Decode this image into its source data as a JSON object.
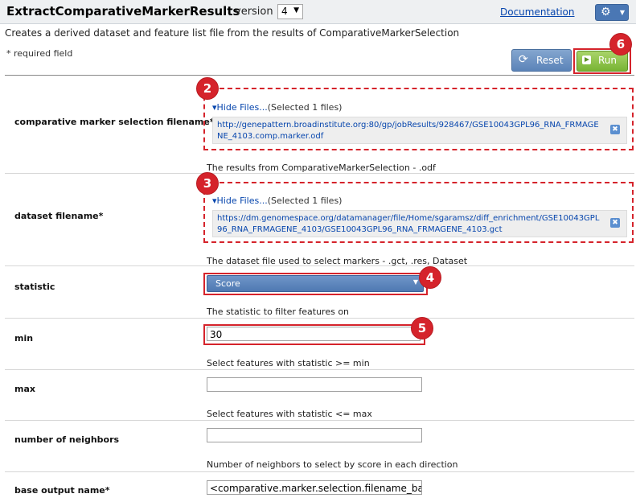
{
  "header": {
    "title": "ExtractComparativeMarkerResults",
    "version_label": "version",
    "version_value": "4",
    "documentation_link": "Documentation",
    "gear_icon": "gear-icon"
  },
  "subtitle": "Creates a derived dataset and feature list file from the results of ComparativeMarkerSelection",
  "required_note": "* required field",
  "actions": {
    "reset_label": "Reset",
    "run_label": "Run"
  },
  "params": {
    "cms_filename": {
      "label": "comparative marker selection filename*",
      "toggle": "▾Hide Files...",
      "selected": "(Selected 1 files)",
      "file": "http://genepattern.broadinstitute.org:80/gp/jobResults/928467/GSE10043GPL96_RNA_FRMAGENE_4103.comp.marker.odf",
      "description": "The results from ComparativeMarkerSelection - .odf"
    },
    "dataset_filename": {
      "label": "dataset filename*",
      "toggle": "▾Hide Files...",
      "selected": "(Selected 1 files)",
      "file": "https://dm.genomespace.org/datamanager/file/Home/sgaramsz/diff_enrichment/GSE10043GPL96_RNA_FRMAGENE_4103/GSE10043GPL96_RNA_FRMAGENE_4103.gct",
      "description": "The dataset file used to select markers - .gct, .res, Dataset"
    },
    "statistic": {
      "label": "statistic",
      "value": "Score",
      "description": "The statistic to filter features on"
    },
    "min": {
      "label": "min",
      "value": "30",
      "description": "Select features with statistic >= min"
    },
    "max": {
      "label": "max",
      "value": "",
      "description": "Select features with statistic <= max"
    },
    "neighbors": {
      "label": "number of neighbors",
      "value": "",
      "description": "Number of neighbors to select by score in each direction"
    },
    "base_output": {
      "label": "base output name*",
      "value": "<comparative.marker.selection.filename_basename>"
    }
  },
  "badges": [
    "2",
    "3",
    "4",
    "5",
    "6"
  ],
  "colors": {
    "annotation_red": "#d5232b",
    "link_blue": "#0645ad",
    "run_green": "#78b433",
    "reset_blue": "#5b83b8"
  }
}
